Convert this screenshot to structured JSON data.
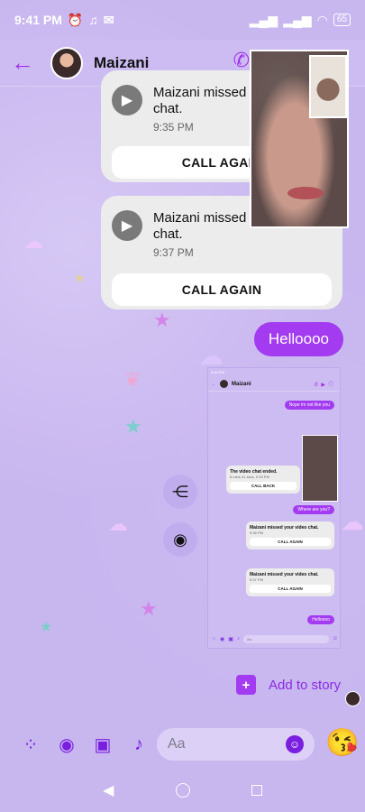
{
  "status_bar": {
    "time": "9:41 PM",
    "battery": "65"
  },
  "header": {
    "contact_name": "Maizani"
  },
  "messages": {
    "call1": {
      "title": "Maizani missed your video chat.",
      "time": "9:35 PM",
      "action": "CALL AGAIN"
    },
    "call2": {
      "title": "Maizani missed your video chat.",
      "time": "9:37 PM",
      "action": "CALL AGAIN"
    },
    "sent_text": "Helloooo"
  },
  "shared_screenshot": {
    "time": "9:40 PM",
    "contact_name": "Maizani",
    "msg1": "Nope im not like you",
    "card1_title": "The video chat ended.",
    "card1_meta": "6 mins 41 secs, 9:33 PM",
    "card1_action": "CALL BACK",
    "msg2": "Where are you?",
    "card2_title": "Maizani missed your video chat.",
    "card2_meta": "9:35 PM",
    "card2_action": "CALL AGAIN",
    "card3_title": "Maizani missed your video chat.",
    "card3_meta": "9:37 PM",
    "card3_action": "CALL AGAIN",
    "msg3": "Helloooo",
    "placeholder": "Aa"
  },
  "add_story_label": "Add to story",
  "composer": {
    "placeholder": "Aa"
  },
  "colors": {
    "accent": "#a33bf0",
    "background": "#c8b6ef"
  }
}
